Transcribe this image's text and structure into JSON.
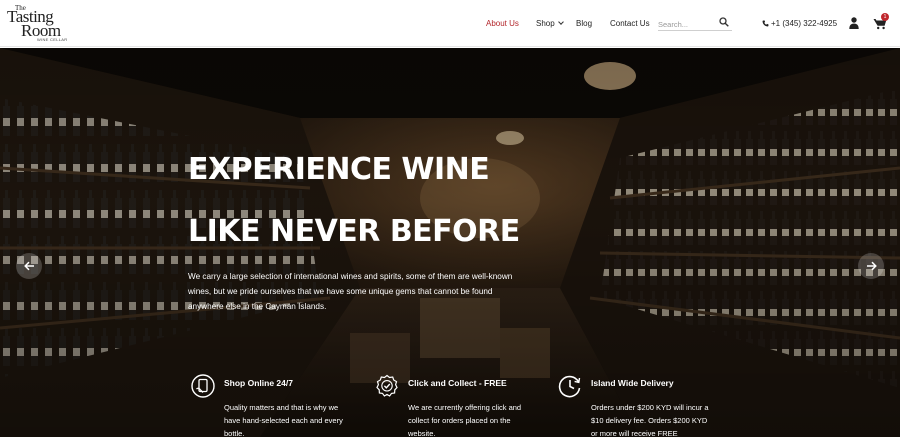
{
  "logo": {
    "line1": "The",
    "line2": "Tasting",
    "line3": "Room",
    "line4": "WINE CELLAR"
  },
  "nav": {
    "about": "About Us",
    "shop": "Shop",
    "blog": "Blog",
    "contact": "Contact Us"
  },
  "search": {
    "placeholder": "Search..."
  },
  "phone": "+1 (345) 322-4925",
  "cart": {
    "count": "1"
  },
  "colors": {
    "accent": "#b3252a",
    "badge": "#c0272d"
  },
  "icons": {
    "search": "search-icon",
    "phone": "phone-icon",
    "user": "user-icon",
    "cart": "cart-icon",
    "prev": "arrow-left-icon",
    "next": "arrow-right-icon",
    "shop": "phone-hand-icon",
    "collect": "check-badge-icon",
    "delivery": "clock-icon"
  },
  "hero": {
    "headline_1": "EXPERIENCE WINE",
    "headline_2": "LIKE NEVER BEFORE",
    "description": "We carry a large selection of international wines and spirits, some of them are well-known wines, but we pride ourselves that we have some unique gems that cannot be found anywhere else in the Cayman Islands."
  },
  "features": [
    {
      "title": "Shop Online 24/7",
      "text": "Quality matters and that is why we have hand-selected each and every bottle."
    },
    {
      "title": "Click and Collect - FREE",
      "text": "We are currently offering click and collect for orders placed on the website."
    },
    {
      "title": "Island Wide Delivery",
      "text": "Orders under $200 KYD will incur a $10 delivery fee. Orders $200 KYD or more will receive FREE"
    }
  ]
}
